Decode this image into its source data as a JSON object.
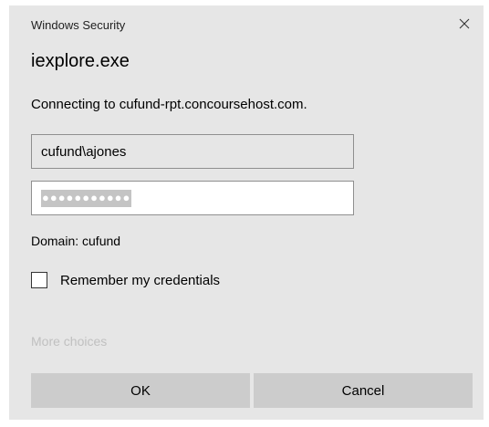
{
  "window": {
    "title": "Windows Security",
    "close_icon": "close-icon"
  },
  "app_name": "iexplore.exe",
  "message": "Connecting to cufund-rpt.concoursehost.com.",
  "username": {
    "value": "cufund\\ajones"
  },
  "password": {
    "masked_value": "●●●●●●●●●●●",
    "selected": true
  },
  "domain_label": "Domain: cufund",
  "remember": {
    "label": "Remember my credentials",
    "checked": false
  },
  "more_choices_label": "More choices",
  "buttons": {
    "ok_label": "OK",
    "cancel_label": "Cancel"
  },
  "colors": {
    "dialog_bg": "#e6e6e6",
    "button_bg": "#cccccc",
    "disabled_text": "#c0c0c0",
    "selection_bg": "#c4c4c4"
  }
}
